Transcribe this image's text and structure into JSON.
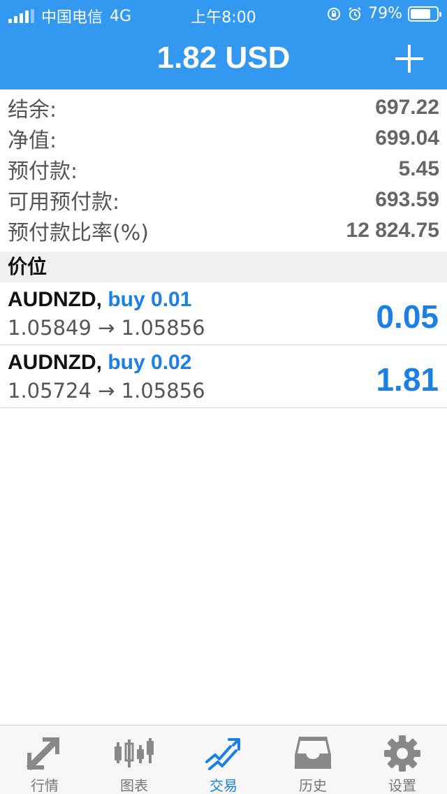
{
  "status": {
    "carrier": "中国电信",
    "network": "4G",
    "time": "上午8:00",
    "battery": "79%",
    "battery_level": 0.79
  },
  "header": {
    "title": "1.82 USD",
    "add_icon": "plus-icon"
  },
  "summary": [
    {
      "label": "结余:",
      "value": "697.22"
    },
    {
      "label": "净值:",
      "value": "699.04"
    },
    {
      "label": "预付款:",
      "value": "5.45"
    },
    {
      "label": "可用预付款:",
      "value": "693.59"
    },
    {
      "label": "预付款比率(%)",
      "value": "12 824.75"
    }
  ],
  "section_title": "价位",
  "positions": [
    {
      "symbol": "AUDNZD,",
      "side": "buy 0.01",
      "prices": "1.05849 → 1.05856",
      "profit": "0.05"
    },
    {
      "symbol": "AUDNZD,",
      "side": "buy 0.02",
      "prices": "1.05724 → 1.05856",
      "profit": "1.81"
    }
  ],
  "tabs": [
    {
      "label": "行情",
      "icon": "quotes-arrows-icon"
    },
    {
      "label": "图表",
      "icon": "candlestick-chart-icon"
    },
    {
      "label": "交易",
      "icon": "trade-trend-icon",
      "active": true
    },
    {
      "label": "历史",
      "icon": "history-inbox-icon"
    },
    {
      "label": "设置",
      "icon": "settings-gear-icon"
    }
  ],
  "colors": {
    "accent": "#3399f0",
    "profit_blue": "#1a80e6",
    "tab_inactive": "#777777"
  }
}
